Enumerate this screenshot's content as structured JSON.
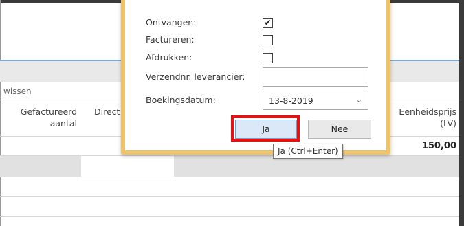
{
  "background": {
    "toolbar_text": "wissen",
    "columns": {
      "invoiced_qty": "Gefactureerd aantal",
      "direct": "Direct",
      "unit_price": "Eenheidsprijs (LV)"
    },
    "row1_unit_price": "150,00"
  },
  "dialog": {
    "received_label": "Ontvangen:",
    "received_checked": true,
    "invoice_label": "Factureren:",
    "invoice_checked": false,
    "print_label": "Afdrukken:",
    "print_checked": false,
    "vendor_shipment_label": "Verzendnr. leverancier:",
    "vendor_shipment_value": "",
    "posting_date_label": "Boekingsdatum:",
    "posting_date_value": "13-8-2019",
    "yes_button": "Ja",
    "no_button": "Nee",
    "tooltip": "Ja (Ctrl+Enter)"
  },
  "colors": {
    "dialog_frame": "#efc36a",
    "highlight_box": "#e01414",
    "primary_button": "#dbe8f7",
    "header_line": "#7fa7d6"
  },
  "icons": {
    "check": "checkmark-icon",
    "dropdown": "chevron-down-icon"
  }
}
